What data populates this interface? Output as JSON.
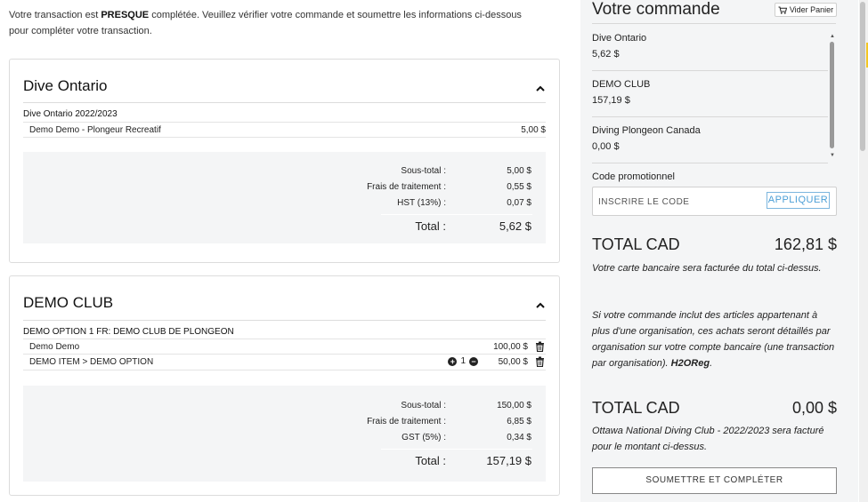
{
  "intro": {
    "before": "Votre transaction est ",
    "strong": "PRESQUE",
    "after": " complétée. Veuillez vérifier votre commande et soumettre les informations ci-dessous pour compléter votre transaction."
  },
  "sections": [
    {
      "title": "Dive Ontario",
      "group": "Dive Ontario 2022/2023",
      "items": [
        {
          "name": "Demo Demo - Plongeur Recreatif",
          "price": "5,00 $"
        }
      ],
      "summary": [
        {
          "label": "Sous-total :",
          "value": "5,00 $"
        },
        {
          "label": "Frais de traitement :",
          "value": "0,55 $"
        },
        {
          "label": "HST (13%) :",
          "value": "0,07 $"
        }
      ],
      "total_label": "Total :",
      "total_value": "5,62 $"
    },
    {
      "title": "DEMO CLUB",
      "group": "DEMO OPTION 1 FR: DEMO CLUB DE PLONGEON",
      "items": [
        {
          "name": "Demo Demo",
          "price": "100,00 $"
        },
        {
          "name": "DEMO ITEM > DEMO OPTION",
          "qty": "1",
          "price": "50,00 $"
        }
      ],
      "summary": [
        {
          "label": "Sous-total :",
          "value": "150,00 $"
        },
        {
          "label": "Frais de traitement :",
          "value": "6,85 $"
        },
        {
          "label": "GST (5%) :",
          "value": "0,34 $"
        }
      ],
      "total_label": "Total :",
      "total_value": "157,19 $"
    }
  ],
  "order": {
    "title": "Votre commande",
    "clear_label": "Vider Panier",
    "items": [
      {
        "name": "Dive Ontario",
        "price": "5,62 $"
      },
      {
        "name": "DEMO CLUB",
        "price": "157,19 $"
      },
      {
        "name": "Diving Plongeon Canada",
        "price": "0,00 $"
      }
    ],
    "promo_label": "Code promotionnel",
    "promo_placeholder": "INSCRIRE LE CODE",
    "apply_label": "APPLIQUER",
    "total1_label": "TOTAL CAD",
    "total1_value": "162,81 $",
    "note1": "Votre carte bancaire sera facturée du total ci-dessus.",
    "note2": "Si votre commande inclut des articles appartenant à plus d'une organisation, ces achats seront détaillés par organisation sur votre compte bancaire (une transaction par organisation).",
    "note2_brand": "H2OReg",
    "note2_end": ".",
    "total2_label": "TOTAL CAD",
    "total2_value": "0,00 $",
    "note3": "Ottawa National Diving Club - 2022/2023 sera facturé pour le montant ci-dessus.",
    "submit_label": "SOUMETTRE ET COMPLÉTER"
  },
  "icons": {
    "chevron": "chevron-up-icon",
    "trash": "trash-icon",
    "cart": "cart-icon",
    "plus": "plus-circle-icon",
    "minus": "minus-circle-icon"
  },
  "colors": {
    "panel_bg": "#f4f5f6",
    "apply_accent": "#4b9ed6",
    "border": "#dcdcdc"
  }
}
